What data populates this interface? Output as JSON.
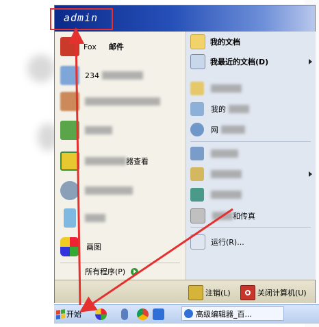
{
  "user": {
    "name": "admin"
  },
  "left_items": [
    {
      "label": "邮件",
      "partial": "Fox"
    },
    {
      "label": "234"
    },
    {
      "label": ""
    },
    {
      "label": ""
    },
    {
      "label": "器查看"
    },
    {
      "label": ""
    },
    {
      "label": ""
    },
    {
      "label": "画图"
    }
  ],
  "all_programs": {
    "label": "所有程序(P)"
  },
  "right_items": [
    {
      "label": "我的文档"
    },
    {
      "label": "我最近的文档(D)"
    },
    {
      "label": ""
    },
    {
      "label": "我的"
    },
    {
      "label": "网"
    },
    {
      "label": ""
    },
    {
      "label": ""
    },
    {
      "label": ""
    },
    {
      "label": "和传真"
    },
    {
      "label": "运行(R)..."
    }
  ],
  "footer": {
    "logoff": "注销(L)",
    "shutdown": "关闭计算机(U)"
  },
  "taskbar": {
    "start": "开始",
    "window_title": "高级编辑器_百..."
  },
  "colors": {
    "header_dark": "#0b2a8a",
    "annotation_red": "#e53030"
  }
}
